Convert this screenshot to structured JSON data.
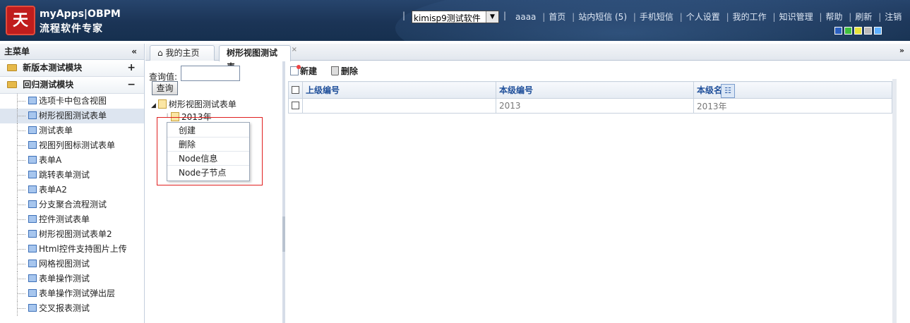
{
  "header": {
    "logo_char": "天",
    "brand_top": "myApps|OBPM",
    "brand_bottom": "流程软件专家",
    "app_select_value": "kimisp9测试软件",
    "user": "aaaa",
    "nav": [
      "首页",
      "站内短信 (5)",
      "手机短信",
      "个人设置",
      "我的工作",
      "知识管理",
      "帮助",
      "刷新",
      "注销"
    ],
    "swatch_colors": [
      "#2a5fc0",
      "#3fbf3f",
      "#e6e23a",
      "#b9b9b9",
      "#5fb0ff"
    ]
  },
  "sidebar": {
    "title": "主菜单",
    "collapse_glyph": "«",
    "modules": [
      {
        "label": "新版本测试模块",
        "toggle": "+"
      },
      {
        "label": "回归测试模块",
        "toggle": "−"
      }
    ],
    "items": [
      "选项卡中包含视图",
      "树形视图测试表单",
      "测试表单",
      "视图列图标测试表单",
      "表单A",
      "跳转表单测试",
      "表单A2",
      "分支聚合流程测试",
      "控件测试表单",
      "树形视图测试表单2",
      "Html控件支持图片上传",
      "网格视图测试",
      "表单操作测试",
      "表单操作测试弹出层",
      "交叉报表测试"
    ]
  },
  "tabs": {
    "home": "我的主页",
    "active": "树形视图测试表",
    "close_glyph": "×",
    "scroll_glyph": "»"
  },
  "tree": {
    "query_label": "查询值:",
    "query_value": "",
    "query_button": "查询",
    "root_label": "树形视图测试表单",
    "node_label": "2013年"
  },
  "context_menu": [
    "创建",
    "删除",
    "Node信息",
    "Node子节点"
  ],
  "toolbar": {
    "new_label": "新建",
    "delete_label": "删除"
  },
  "grid": {
    "columns": [
      "上级编号",
      "本级编号",
      "本级名称"
    ],
    "rows": [
      [
        "",
        "2013",
        "2013年"
      ]
    ]
  }
}
